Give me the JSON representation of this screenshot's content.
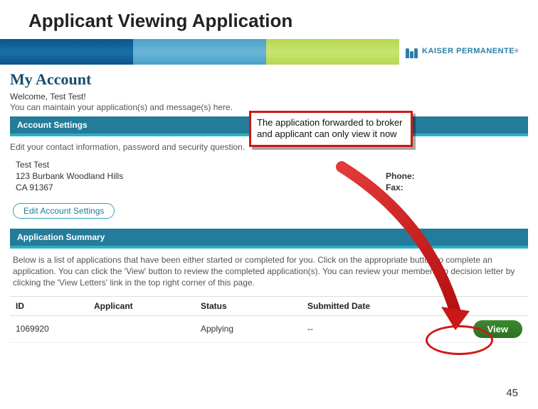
{
  "slide": {
    "title": "Applicant Viewing Application",
    "page_number": "45"
  },
  "brand": {
    "name": "KAISER PERMANENTE"
  },
  "page": {
    "title": "My Account",
    "welcome": "Welcome, Test Test!",
    "subtext": "You can maintain your application(s) and message(s) here."
  },
  "account_settings": {
    "header": "Account Settings",
    "description": "Edit your contact information, password and security question.",
    "name": "Test Test",
    "address_line1": "123 Burbank Woodland Hills",
    "address_line2": "CA 91367",
    "phone_label": "Phone:",
    "fax_label": "Fax:",
    "edit_button": "Edit Account Settings"
  },
  "application_summary": {
    "header": "Application Summary",
    "description": "Below is a list of applications that have been either started or completed for you. Click on the appropriate button to complete an application. You can click the 'View' button to review the completed application(s). You can review your membership decision letter by clicking the 'View Letters' link in the top right corner of this page.",
    "columns": {
      "id": "ID",
      "applicant": "Applicant",
      "status": "Status",
      "submitted": "Submitted Date"
    },
    "rows": [
      {
        "id": "1069920",
        "applicant": "",
        "status": "Applying",
        "submitted": "--",
        "action": "View"
      }
    ]
  },
  "callout": {
    "text": "The application forwarded to broker and applicant can only view it now"
  }
}
